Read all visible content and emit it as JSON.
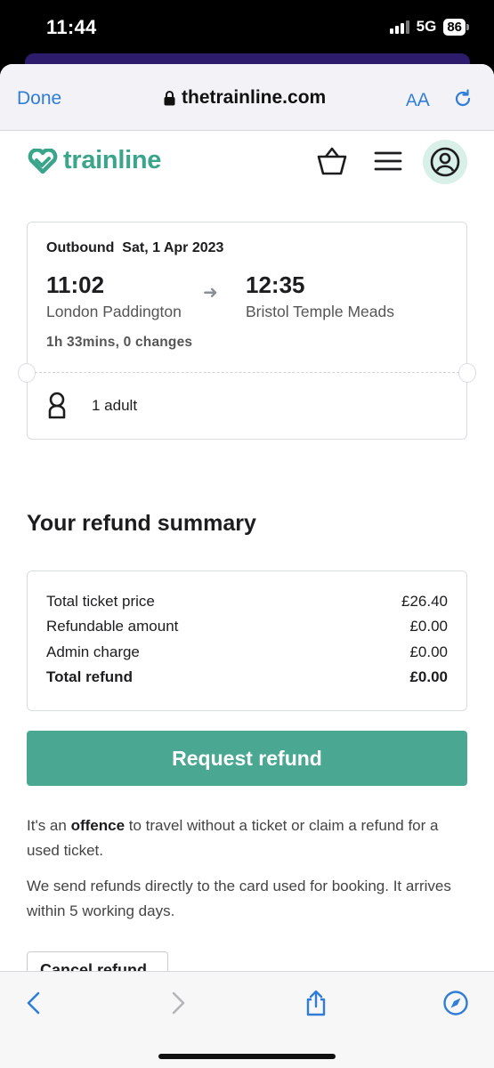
{
  "status": {
    "time": "11:44",
    "network": "5G",
    "battery": "86"
  },
  "browser": {
    "done_label": "Done",
    "url": "thetrainline.com",
    "aa_small": "A",
    "aa_big": "A"
  },
  "site": {
    "logo_text": "trainline",
    "brand_color": "#3aa58a",
    "icons": [
      "basket-icon",
      "menu-icon",
      "account-icon"
    ]
  },
  "journey": {
    "label": "Outbound  Sat, 1 Apr 2023",
    "departure_time": "11:02",
    "departure_station": "London Paddington",
    "arrow": "➜",
    "arrival_time": "12:35",
    "arrival_station": "Bristol Temple Meads",
    "duration": "1h 33mins, 0 changes",
    "passengers": "1 adult"
  },
  "summary": {
    "title": "Your refund summary",
    "rows": [
      {
        "label": "Total ticket price",
        "value": "£26.40"
      },
      {
        "label": "Refundable amount",
        "value": "£0.00"
      },
      {
        "label": "Admin charge",
        "value": "£0.00"
      },
      {
        "label": "Total refund",
        "value": "£0.00"
      }
    ]
  },
  "refund_button": "Request refund",
  "notice": {
    "p1_pre": "It's an ",
    "p1_bold": "offence",
    "p1_post": " to travel without a ticket or claim a refund for a used ticket.",
    "p2": "We send refunds directly to the card used for booking. It arrives within 5 working days."
  },
  "cancel_button": "Cancel refund",
  "accent_color": "#4aa892",
  "toolbar_icons": [
    "back-icon",
    "forward-icon",
    "share-icon",
    "compass-icon"
  ]
}
